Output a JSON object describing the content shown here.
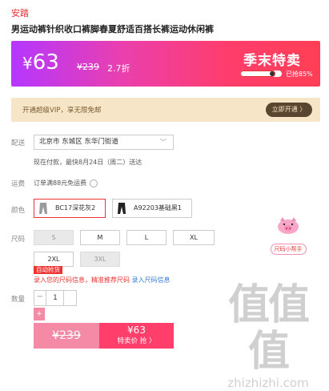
{
  "product": {
    "brand": "安踏",
    "title": "男运动裤针织收口裤脚春夏舒适百搭长裤运动休闲裤"
  },
  "promo": {
    "currency": "¥",
    "price": "63",
    "original_price": "¥239",
    "discount": "2.7折",
    "season_label": "季末特卖",
    "sold_text": "已抢85%",
    "sold_fraction": 0.85
  },
  "vip": {
    "text": "开通超级VIP，享无限免邮",
    "button": "立即开通 〉"
  },
  "delivery": {
    "label": "配送",
    "address": "北京市 东城区 东华门街道",
    "eta": "现在付款，最快8月24日（周二）送达"
  },
  "shipping": {
    "label": "运费",
    "text": "订单满88元免运费",
    "info_icon": "question-circle-icon"
  },
  "colors": {
    "label": "颜色",
    "options": [
      {
        "label": "BC17深花灰2",
        "selected": true
      },
      {
        "label": "A92203基础黑1",
        "selected": false
      }
    ]
  },
  "sizes": {
    "label": "尺码",
    "options": [
      {
        "label": "S",
        "disabled": true
      },
      {
        "label": "M",
        "disabled": false
      },
      {
        "label": "L",
        "disabled": false
      },
      {
        "label": "XL",
        "disabled": false
      },
      {
        "label": "2XL",
        "disabled": false,
        "tag": "自动抢货"
      },
      {
        "label": "3XL",
        "disabled": true
      }
    ],
    "hint": "录入您的尺码信息，精准推荐尺码 ",
    "hint_link": "录入尺码信息",
    "helper_label": "尺码小帮手"
  },
  "quantity": {
    "label": "数量",
    "minus": "−",
    "value": "1",
    "add_symbol": "+"
  },
  "buy": {
    "original_price": "¥239",
    "sale_price": "¥63",
    "sale_label": "特卖价 抢 〉"
  },
  "watermark": {
    "chars": "值值值",
    "url": "zhizhizhi.com"
  },
  "colors_theme": {
    "accent": "#ff3e6c",
    "brand_red": "#e33333",
    "vip_bg": "#f6e6c7"
  }
}
